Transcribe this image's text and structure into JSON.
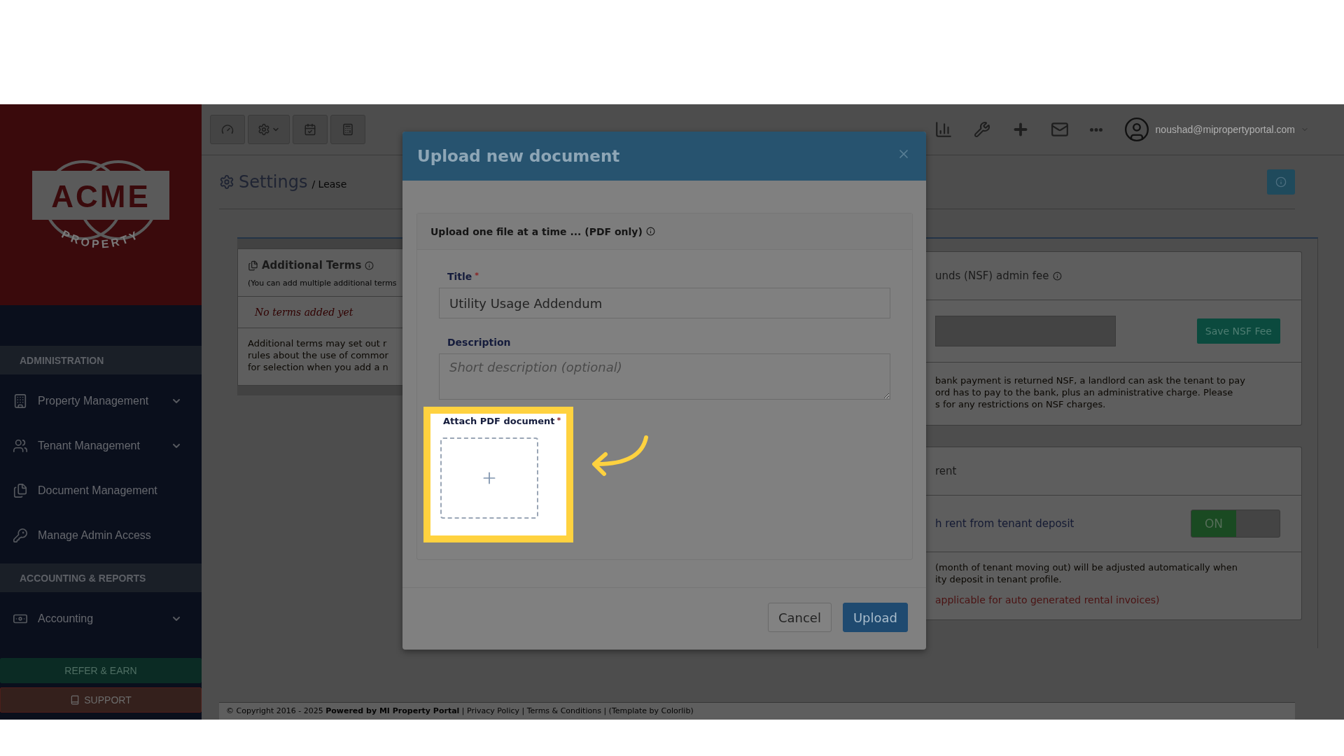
{
  "sidebar": {
    "logo": {
      "name": "ACME",
      "tagline": "PROPERTY"
    },
    "sections": [
      {
        "heading": "ADMINISTRATION",
        "items": [
          {
            "label": "Property Management",
            "kind": "building",
            "expandable": true
          },
          {
            "label": "Tenant Management",
            "kind": "users",
            "expandable": true
          },
          {
            "label": "Document Management",
            "kind": "files",
            "expandable": false
          },
          {
            "label": "Manage Admin Access",
            "kind": "key",
            "expandable": false
          }
        ]
      },
      {
        "heading": "ACCOUNTING & REPORTS",
        "items": [
          {
            "label": "Accounting",
            "kind": "money",
            "expandable": true
          }
        ]
      }
    ],
    "refer_button": "REFER & EARN",
    "support_button": "SUPPORT"
  },
  "toolbar": {
    "user_email": "noushad@mipropertyportal.com"
  },
  "page_header": {
    "title": "Settings",
    "crumb": "/ Lease"
  },
  "left_card": {
    "title": "Additional Terms",
    "subtitle": "(You can add multiple additional terms",
    "empty_text": "No terms added yet",
    "info_lines": [
      "Additional terms may set out r",
      "rules about the use of commor",
      "for selection when you add a n"
    ]
  },
  "right_card": {
    "nsf_title": "unds (NSF) admin fee",
    "save_button": "Save NSF Fee",
    "nsf_lines": [
      "bank payment is returned NSF, a landlord can ask the tenant to pay",
      "ord has to pay to the bank, plus an administrative charge. Please",
      "s for any restrictions on NSF charges."
    ],
    "rent_title": "rent",
    "toggle_label": "h rent from tenant deposit",
    "toggle": {
      "text": "ON",
      "on": true
    },
    "rent_lines": [
      "(month of tenant moving out) will be adjusted automatically when",
      "ity deposit in tenant profile."
    ],
    "rent_note": "applicable for auto generated rental invoices)"
  },
  "modal": {
    "title": "Upload new document",
    "panel_heading": "Upload one file at a time ... (PDF only)",
    "title_field": {
      "label": "Title",
      "mark": "*",
      "value": "Utility Usage Addendum"
    },
    "description_field": {
      "label": "Description",
      "placeholder": "Short description (optional)"
    },
    "attach_field": {
      "label": "Attach PDF document",
      "mark": "*",
      "highlighted": true
    },
    "buttons": [
      {
        "label": "Cancel",
        "kind": "secondary"
      },
      {
        "label": "Upload",
        "kind": "primary"
      }
    ]
  },
  "footer": "© Copyright 2016 - 2025 **Powered by MI Property Portal** | Privacy Policy | Terms & Conditions | (Template by Colorlib)"
}
